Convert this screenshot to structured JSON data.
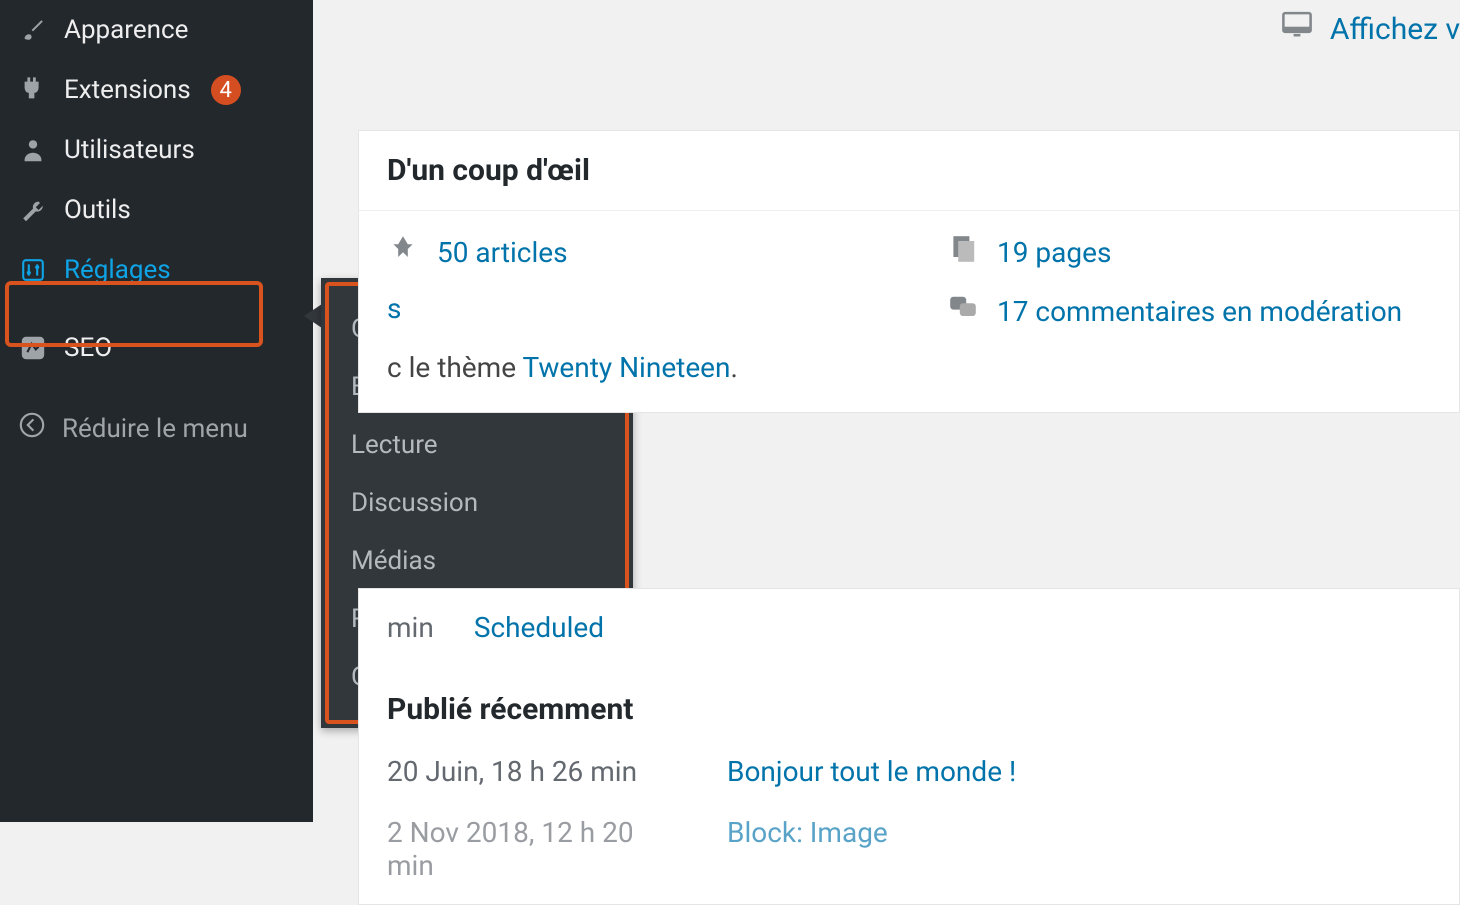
{
  "sidebar": {
    "items": [
      {
        "label": "Apparence",
        "icon": "brush"
      },
      {
        "label": "Extensions",
        "icon": "plugin",
        "badge": "4"
      },
      {
        "label": "Utilisateurs",
        "icon": "user"
      },
      {
        "label": "Outils",
        "icon": "wrench"
      },
      {
        "label": "Réglages",
        "icon": "sliders",
        "active": true
      },
      {
        "label": "SEO",
        "icon": "seo"
      }
    ],
    "collapse": "Réduire le menu"
  },
  "submenu": {
    "items": [
      "Général",
      "Écriture",
      "Lecture",
      "Discussion",
      "Médias",
      "Permaliens",
      "Confidentialité"
    ]
  },
  "top_right": {
    "label": "Affichez v"
  },
  "glance": {
    "title": "D'un coup d'œil",
    "articles": "50 articles",
    "pages": "19 pages",
    "theme_text_suffix": "c le thème ",
    "theme_link": "Twenty Nineteen",
    "comments": "17 commentaires en modération"
  },
  "scheduled": {
    "time_suffix": "min",
    "label": "Scheduled"
  },
  "recent": {
    "title": "Publié récemment",
    "rows": [
      {
        "date": "20 Juin, 18 h 26 min",
        "link": "Bonjour tout le monde !"
      },
      {
        "date": "2 Nov 2018, 12 h 20 min",
        "link": "Block: Image"
      }
    ]
  }
}
